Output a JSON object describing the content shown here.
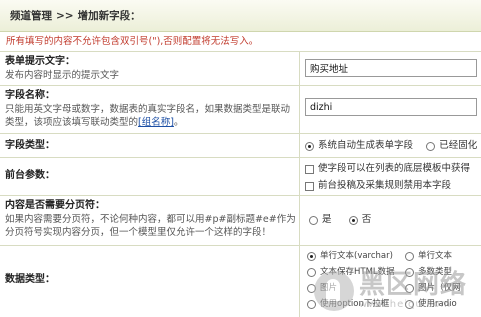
{
  "breadcrumb": {
    "section": "频道管理",
    "separator": ">>",
    "current": "增加新字段："
  },
  "warning": "所有填写的内容不允许包含双引号(\"),否则配置将无法写入。",
  "fields": {
    "form_hint": {
      "label": "表单提示文字：",
      "desc": "发布内容时显示的提示文字",
      "value": "购买地址"
    },
    "field_name": {
      "label": "字段名称：",
      "desc": "只能用英文字母或数字，数据表的真实字段名，如果数据类型是联动类型，该项应该填写联动类型的",
      "link": "[组名称]",
      "desc_end": "。",
      "value": "dizhi"
    },
    "field_type": {
      "label": "字段类型：",
      "options": [
        {
          "text": "系统自动生成表单字段",
          "selected": true
        },
        {
          "text": "已经固化",
          "selected": false
        }
      ]
    },
    "frontend": {
      "label": "前台参数：",
      "checks": [
        {
          "text": "使字段可以在列表的底层模板中获得",
          "checked": false
        },
        {
          "text": "前台投稿及采集规则禁用本字段",
          "checked": false
        }
      ]
    },
    "paging": {
      "label": "内容是否需要分页符：",
      "desc": "如果内容需要分页符，不论何种内容，都可以用#p#副标题#e#作为分页符号实现内容分页，但一个模型里仅允许一个这样的字段！",
      "options": [
        {
          "text": "是",
          "selected": false
        },
        {
          "text": "否",
          "selected": true
        }
      ]
    },
    "data_type": {
      "label": "数据类型：",
      "options": [
        {
          "text": "单行文本(varchar)",
          "selected": true
        },
        {
          "text": "单行文本",
          "selected": false
        },
        {
          "text": "文本保存HTML数据",
          "selected": false
        },
        {
          "text": "多数类型",
          "selected": false
        },
        {
          "text": "图片",
          "selected": false
        },
        {
          "text": "图片（仅网",
          "selected": false
        },
        {
          "text": "使用option下拉框",
          "selected": false
        },
        {
          "text": "使用radio",
          "selected": false
        }
      ]
    }
  },
  "watermark": {
    "brand": "黑区网络",
    "url": "www.heiqu.com"
  }
}
